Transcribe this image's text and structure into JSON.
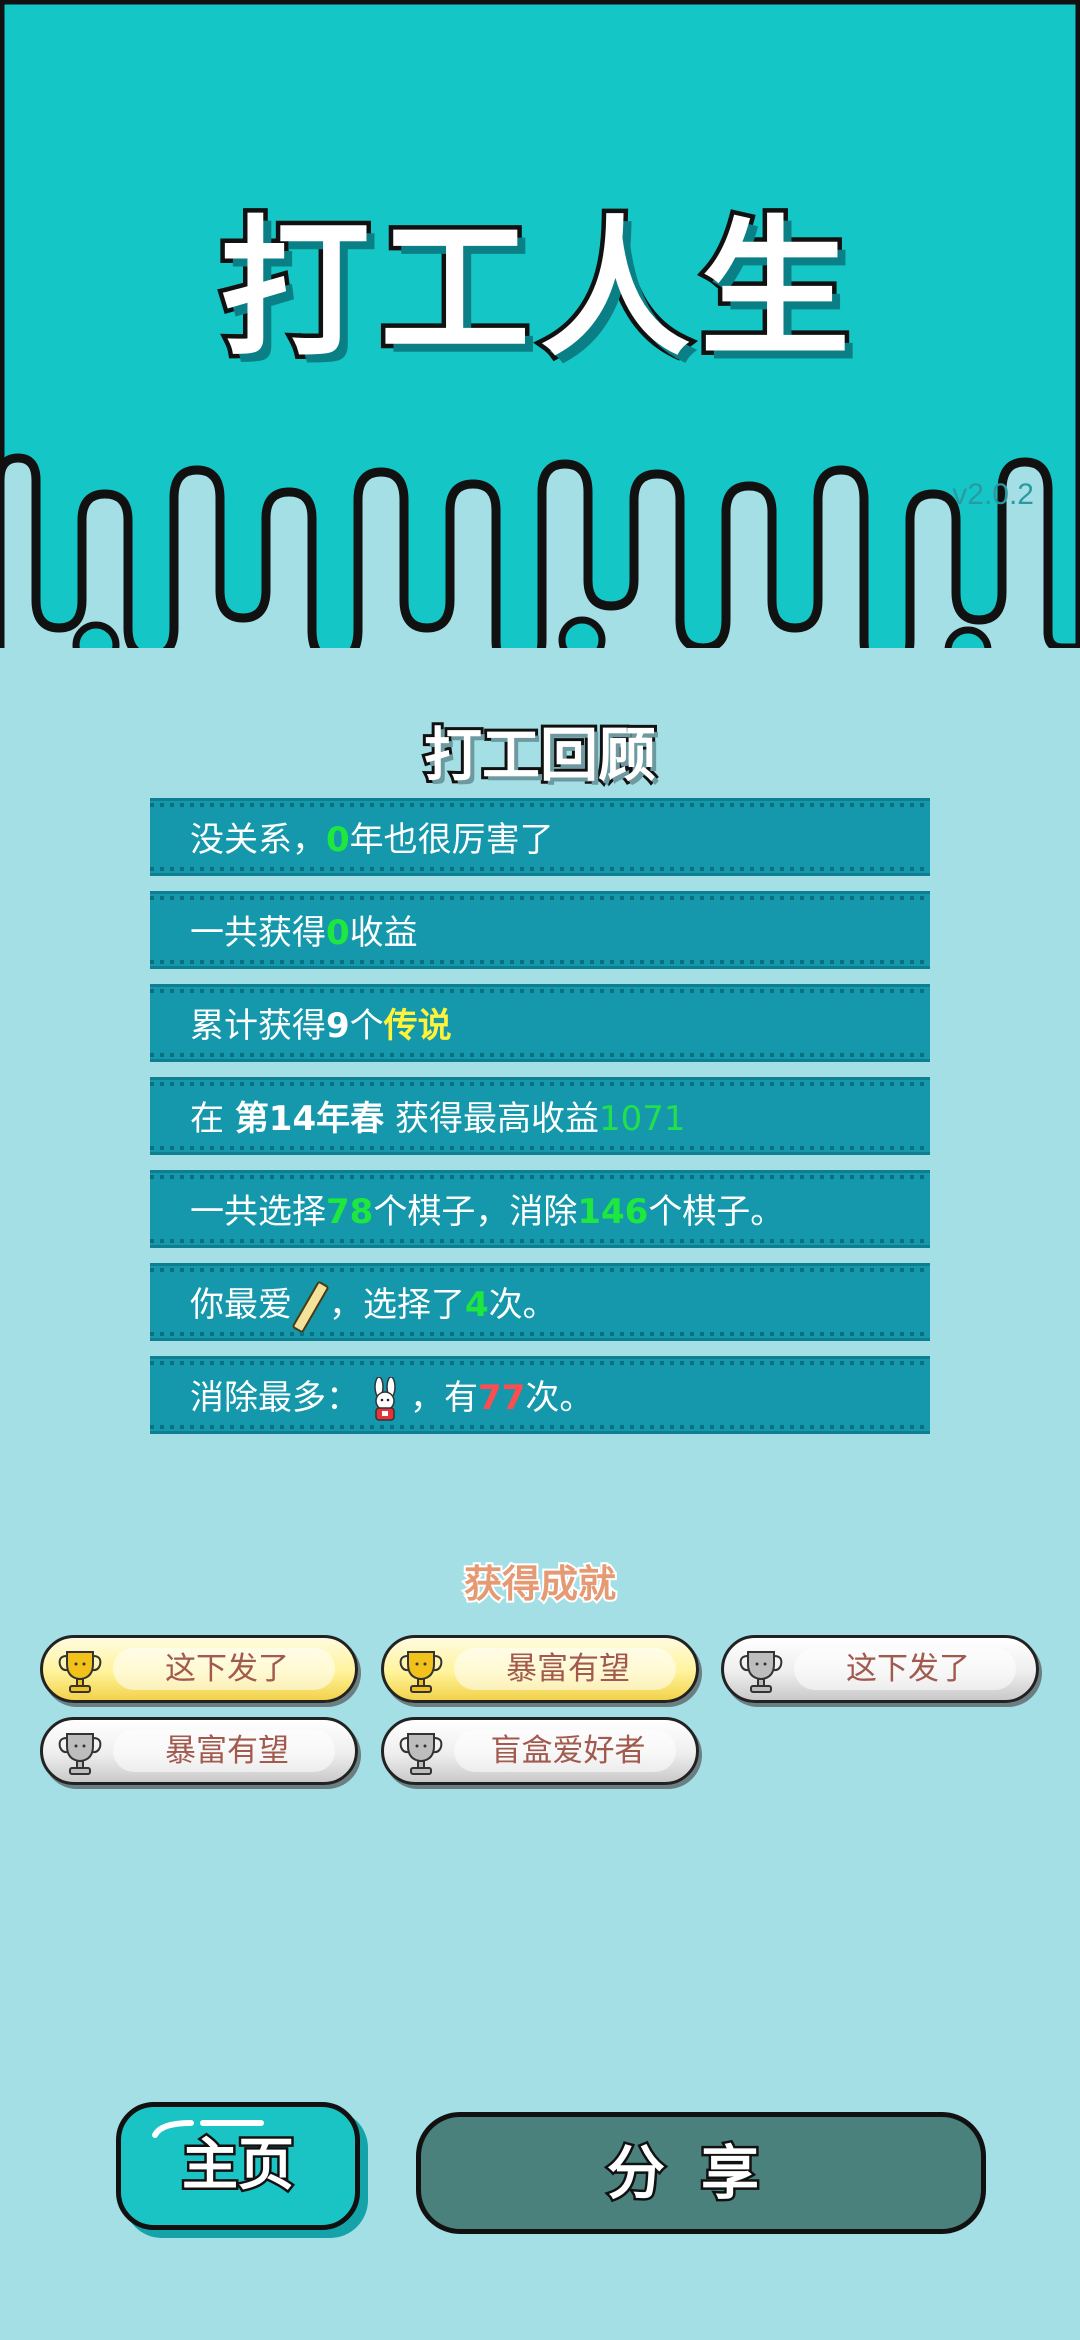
{
  "game": {
    "title": "打工人生",
    "version": "v2.0.2"
  },
  "review": {
    "heading": "打工回顾",
    "lines": [
      {
        "pre": "没关系，",
        "num": "0",
        "post": "年也很厉害了"
      },
      {
        "pre": "一共获得",
        "num": "0",
        "post": "收益"
      },
      {
        "pre": "累计获得",
        "num": "9",
        "mid": "个",
        "rarity": "传说"
      },
      {
        "pre": "在 ",
        "season": "第14年春",
        "mid": " 获得最高收益",
        "num": "1071"
      },
      {
        "pre": "一共选择",
        "num": "78",
        "mid": "个棋子，消除",
        "num2": "146",
        "post": "个棋子。"
      },
      {
        "pre": "你最爱",
        "item_icon": "stick-icon",
        "mid": "，选择了",
        "num": "4",
        "post": "次。"
      },
      {
        "pre": "消除最多：",
        "item_icon": "rabbit-icon",
        "mid": "，有",
        "num": "77",
        "post": "次。"
      }
    ]
  },
  "achievements": {
    "heading": "获得成就",
    "items": [
      {
        "label": "这下发了",
        "tier": "gold"
      },
      {
        "label": "暴富有望",
        "tier": "gold"
      },
      {
        "label": "这下发了",
        "tier": "silver"
      },
      {
        "label": "暴富有望",
        "tier": "silver"
      },
      {
        "label": "盲盒爱好者",
        "tier": "silver"
      }
    ]
  },
  "buttons": {
    "home": "主页",
    "share": "分享"
  },
  "colors": {
    "top_band": "#15c6c6",
    "background": "#a4dfe6",
    "row_bg": "#1598ab",
    "highlight_green": "#1ee83e",
    "highlight_yellow": "#fff23a",
    "highlight_red": "#ff4d4d"
  }
}
